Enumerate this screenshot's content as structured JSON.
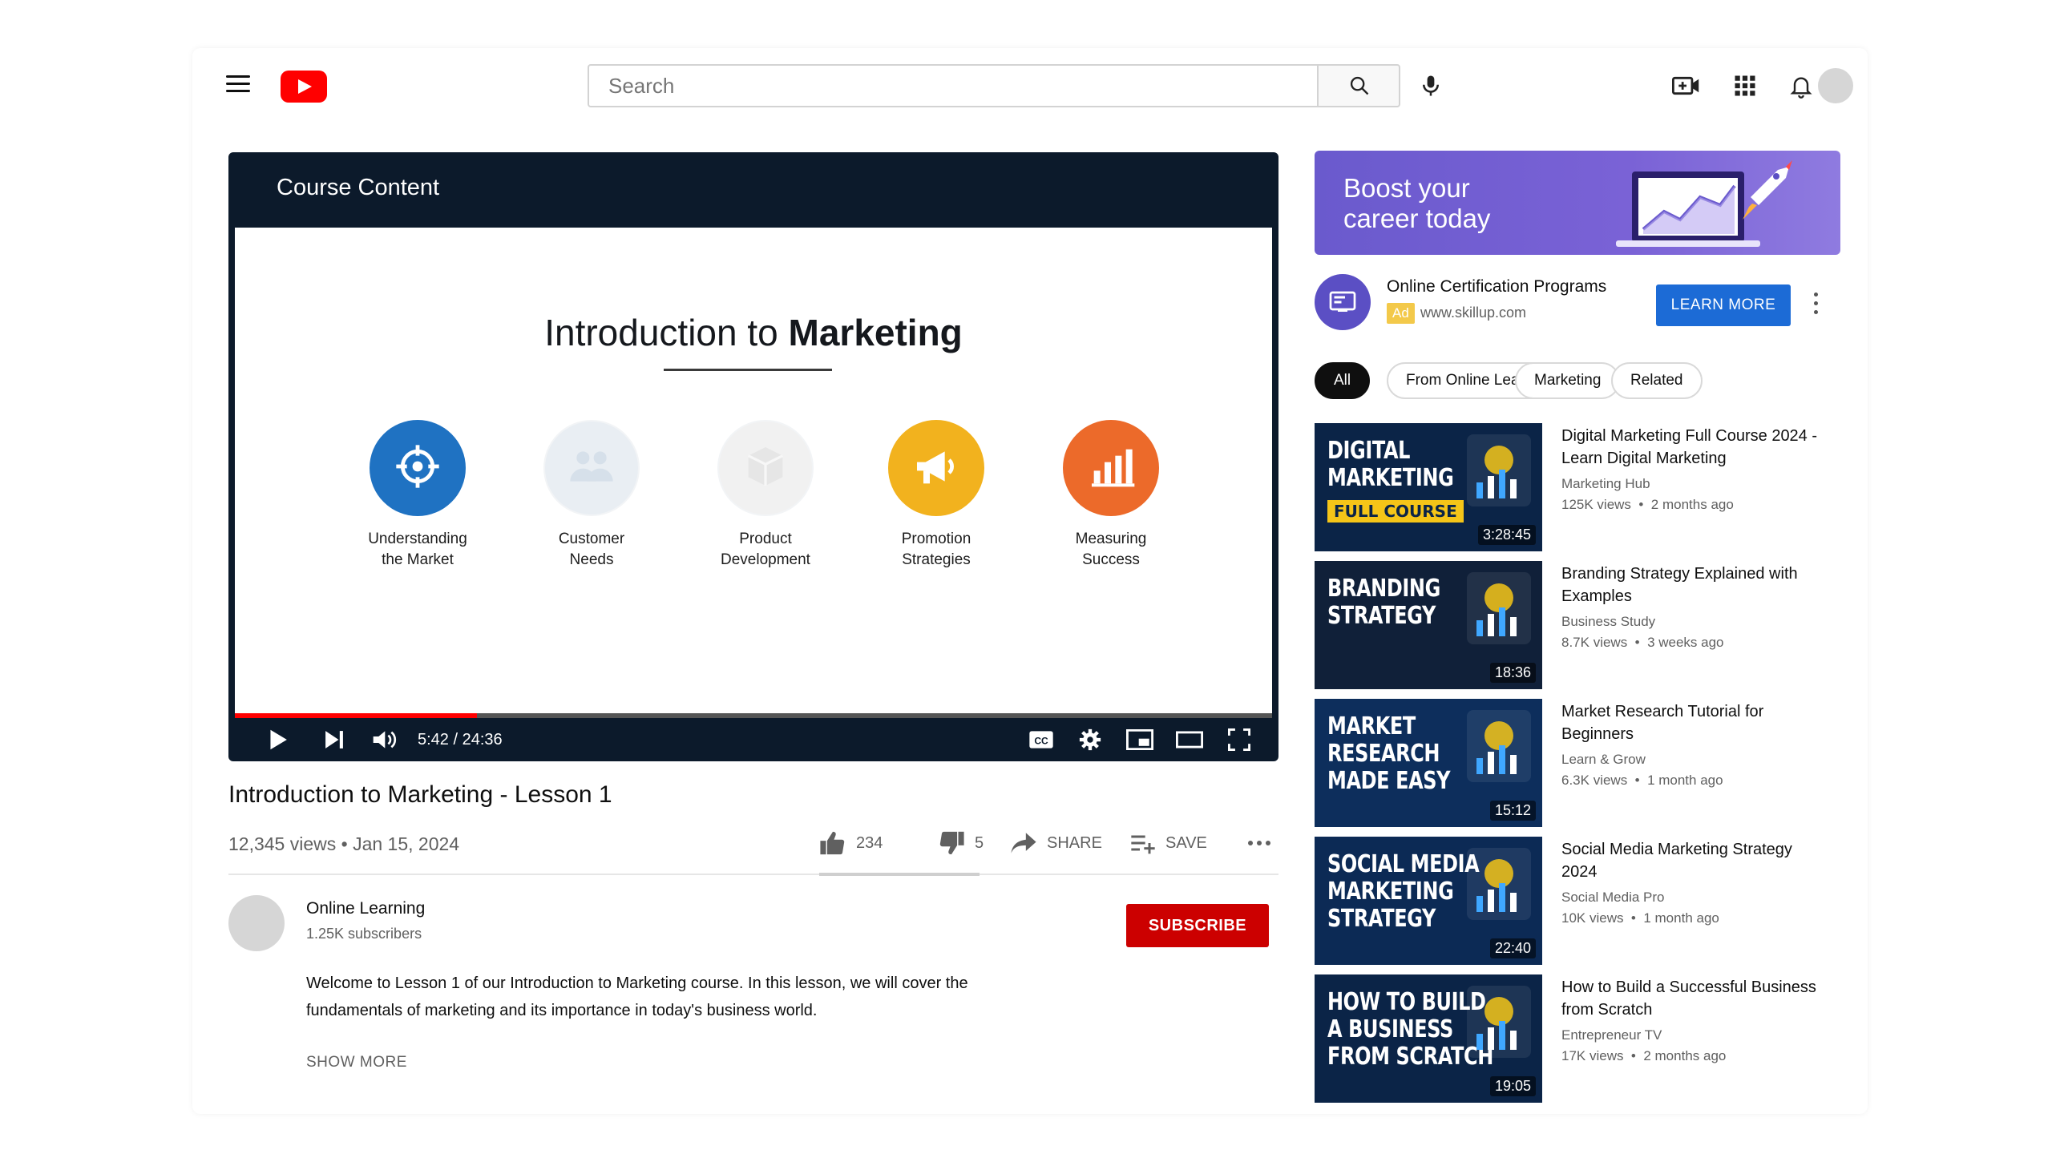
{
  "header": {
    "search_placeholder": "Search"
  },
  "player": {
    "course_header": "Course Content",
    "slide": {
      "title_prefix": "Introduction to",
      "title_bold": "Marketing",
      "topics": [
        {
          "label": "Understanding\nthe Market",
          "color": "#1f72c2",
          "faded": false,
          "icon": "target-icon"
        },
        {
          "label": "Customer\nNeeds",
          "color": "#e9eef3",
          "faded": true,
          "icon": "people-icon"
        },
        {
          "label": "Product\nDevelopment",
          "color": "#f1f1f1",
          "faded": true,
          "icon": "box-icon"
        },
        {
          "label": "Promotion\nStrategies",
          "color": "#f2b21e",
          "faded": false,
          "icon": "megaphone-icon"
        },
        {
          "label": "Measuring\nSuccess",
          "color": "#ec6a2a",
          "faded": false,
          "icon": "bar-chart-icon"
        }
      ]
    },
    "progress_fraction": 0.233,
    "time": "5:42 / 24:36"
  },
  "video": {
    "title": "Introduction to Marketing - Lesson 1",
    "meta": "12,345 views • Jan 15, 2024",
    "likes": "234",
    "dislikes": "5",
    "share_label": "SHARE",
    "save_label": "SAVE"
  },
  "channel": {
    "name": "Online Learning",
    "subscribers": "1.25K subscribers",
    "subscribe_label": "SUBSCRIBE",
    "description": "Welcome to Lesson 1 of our Introduction to Marketing course. In this lesson, we will cover the fundamentals of marketing and its importance in today's business world.",
    "show_more": "SHOW MORE"
  },
  "ad": {
    "banner_text": "Boost your\ncareer today",
    "title": "Online Certification Programs",
    "badge": "Ad",
    "url": "www.skillup.com",
    "cta": "LEARN MORE"
  },
  "chips": [
    "All",
    "From Online Learning",
    "Marketing",
    "Related"
  ],
  "recommendations": [
    {
      "thumb_text": "DIGITAL\nMARKETING",
      "thumb_tag": "FULL COURSE",
      "duration": "3:28:45",
      "title": "Digital Marketing Full Course 2024 - Learn Digital Marketing",
      "channel": "Marketing Hub",
      "views": "125K views",
      "age": "2 months ago",
      "bg": "#0b2447"
    },
    {
      "thumb_text": "BRANDING\nSTRATEGY",
      "thumb_tag": "",
      "duration": "18:36",
      "title": "Branding Strategy Explained with Examples",
      "channel": "Business Study",
      "views": "8.7K views",
      "age": "3 weeks ago",
      "bg": "#102039"
    },
    {
      "thumb_text": "MARKET RESEARCH\nMADE EASY",
      "thumb_tag": "",
      "duration": "15:12",
      "title": "Market Research Tutorial for Beginners",
      "channel": "Learn & Grow",
      "views": "6.3K views",
      "age": "1 month ago",
      "bg": "#0d2e5c"
    },
    {
      "thumb_text": "SOCIAL MEDIA\nMARKETING\nSTRATEGY",
      "thumb_tag": "",
      "duration": "22:40",
      "title": "Social Media Marketing Strategy 2024",
      "channel": "Social Media Pro",
      "views": "10K views",
      "age": "1 month ago",
      "bg": "#0c2a55"
    },
    {
      "thumb_text": "HOW TO BUILD\nA BUSINESS\nFROM SCRATCH",
      "thumb_tag": "",
      "duration": "19:05",
      "title": "How to Build a Successful Business from Scratch",
      "channel": "Entrepreneur TV",
      "views": "17K views",
      "age": "2 months ago",
      "bg": "#0b2447"
    }
  ]
}
